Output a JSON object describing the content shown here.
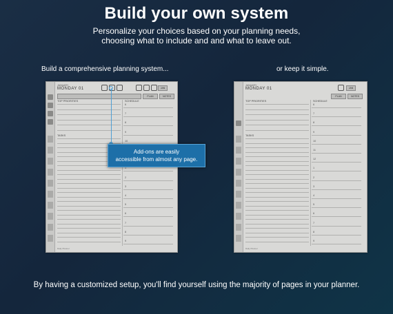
{
  "header": {
    "title": "Build your own system",
    "subtitle_line1": "Personalize your choices based on your planning needs,",
    "subtitle_line2": "choosing what to include and and what to leave out."
  },
  "captions": {
    "left": "Build a comprehensive planning system...",
    "right": "or keep it simple."
  },
  "planner": {
    "month": "JANUARY",
    "day": "MONDAY 01",
    "top_priorities": "TOP PRIORITIES",
    "schedule": "SCHEDULE",
    "tasks": "TASKS",
    "plan_button": "PLAN",
    "notes_button": "NOTES",
    "jan_button": "JAN",
    "hours": [
      "6",
      "7",
      "8",
      "9",
      "10",
      "11",
      "12",
      "1",
      "2",
      "3",
      "4",
      "5",
      "6",
      "7",
      "8",
      "9"
    ],
    "footer": "Daily Planner"
  },
  "tooltip": {
    "line1": "Add-ons are easily",
    "line2": "accessible from almost any page."
  },
  "footer_text": "By having a customized setup, you'll find yourself using the majority of pages in your planner."
}
